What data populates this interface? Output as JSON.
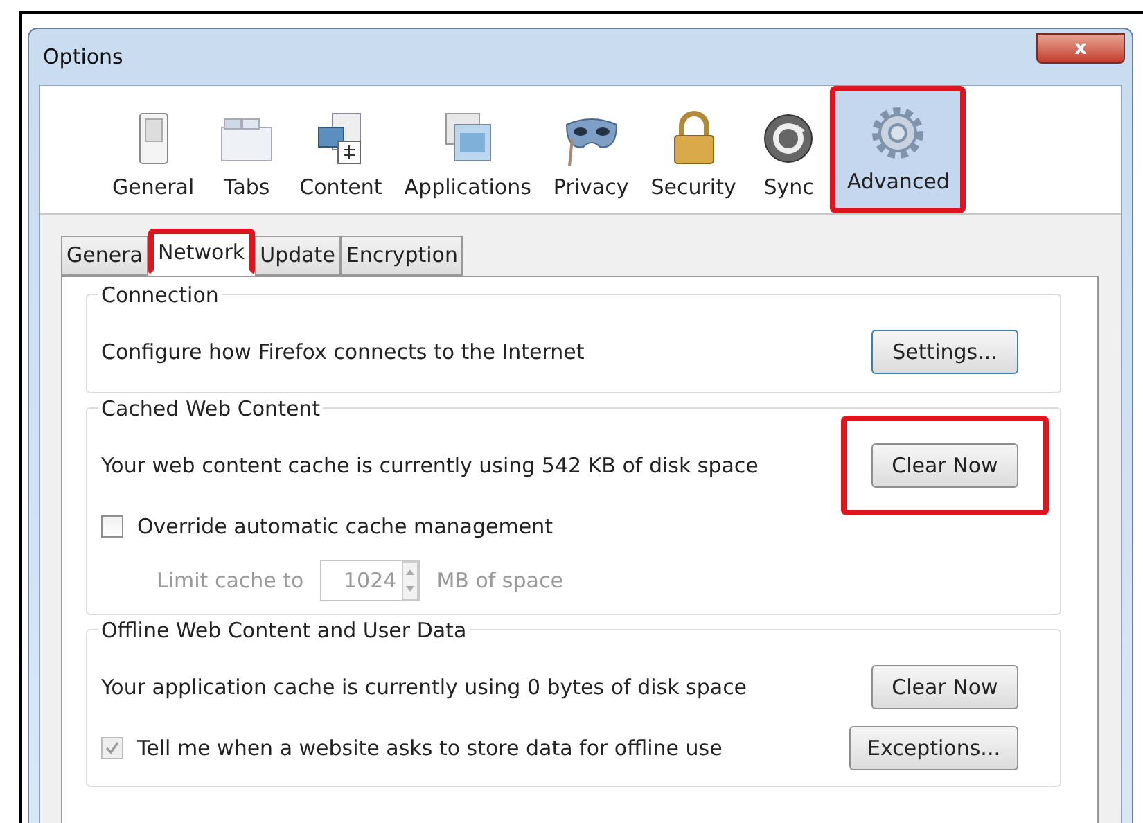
{
  "window": {
    "title": "Options",
    "close": "x"
  },
  "toolbar": [
    {
      "label": "General",
      "kind": "switch",
      "selected": false,
      "highlighted": false
    },
    {
      "label": "Tabs",
      "kind": "tabs",
      "selected": false,
      "highlighted": false
    },
    {
      "label": "Content",
      "kind": "content",
      "selected": false,
      "highlighted": false
    },
    {
      "label": "Applications",
      "kind": "apps",
      "selected": false,
      "highlighted": false
    },
    {
      "label": "Privacy",
      "kind": "mask",
      "selected": false,
      "highlighted": false
    },
    {
      "label": "Security",
      "kind": "lock",
      "selected": false,
      "highlighted": false
    },
    {
      "label": "Sync",
      "kind": "sync",
      "selected": false,
      "highlighted": false
    },
    {
      "label": "Advanced",
      "kind": "gear",
      "selected": true,
      "highlighted": true
    }
  ],
  "tabs": [
    {
      "label": "Genera",
      "selected": false,
      "highlighted": false
    },
    {
      "label": "Network",
      "selected": true,
      "highlighted": true
    },
    {
      "label": "Update",
      "selected": false,
      "highlighted": false
    },
    {
      "label": "Encryption",
      "selected": false,
      "highlighted": false
    }
  ],
  "sections": [
    {
      "title": "Connection",
      "rows": [
        {
          "kind": "text",
          "text": "Configure how Firefox connects to the Internet",
          "button": {
            "label": "Settings...",
            "highlighted": false,
            "focused": true
          }
        }
      ]
    },
    {
      "title": "Cached Web Content",
      "rows": [
        {
          "kind": "text",
          "text": "Your web content cache is currently using 542 KB of disk space",
          "button": {
            "label": "Clear Now",
            "highlighted": true,
            "focused": false
          }
        },
        {
          "kind": "checkbox",
          "text": "Override automatic cache management",
          "checked": false,
          "disabled": false
        },
        {
          "kind": "limit",
          "text": "Limit cache to",
          "value": "1024",
          "unit": "MB of space",
          "disabled": true
        }
      ]
    },
    {
      "title": "Offline Web Content and User Data",
      "rows": [
        {
          "kind": "text",
          "text": "Your application cache is currently using 0 bytes of disk space",
          "button": {
            "label": "Clear Now",
            "highlighted": false,
            "focused": false
          }
        },
        {
          "kind": "checkbox",
          "text": "Tell me when a website asks to store data for offline use",
          "checked": true,
          "disabled": true,
          "button": {
            "label": "Exceptions...",
            "highlighted": false,
            "focused": false
          }
        }
      ]
    }
  ]
}
